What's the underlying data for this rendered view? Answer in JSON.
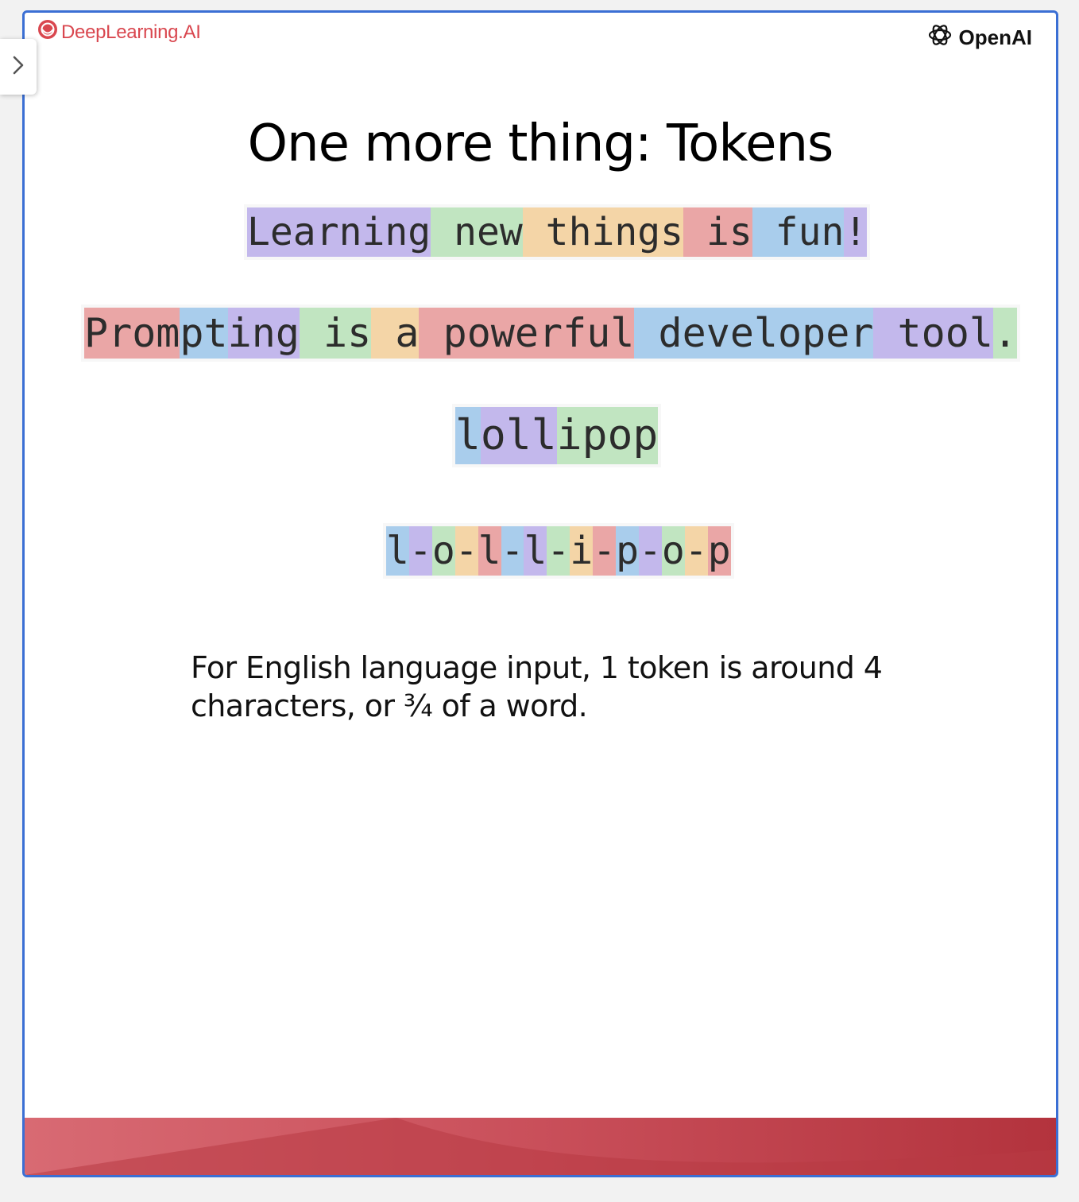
{
  "brand": {
    "left_logo_text": "DeepLearning.AI",
    "right_logo_text": "OpenAI"
  },
  "slide": {
    "title": "One more thing: Tokens",
    "caption": "For English language input, 1 token is around 4 characters, or ¾ of a word."
  },
  "colors": {
    "purple": "#c3b8ec",
    "green": "#c1e5c1",
    "orange": "#f4d5a7",
    "red": "#eaa6a6",
    "blue": "#a9cdec",
    "frame": "#3b6fd4",
    "brand_red": "#d9474f"
  },
  "token_lines": [
    {
      "id": "learning",
      "tokens": [
        {
          "text": "Learning",
          "color": "purple"
        },
        {
          "text": " new",
          "color": "green"
        },
        {
          "text": " things",
          "color": "orange"
        },
        {
          "text": " is",
          "color": "red"
        },
        {
          "text": " fun",
          "color": "blue"
        },
        {
          "text": "!",
          "color": "purple"
        }
      ]
    },
    {
      "id": "prompting",
      "tokens": [
        {
          "text": "Prom",
          "color": "red"
        },
        {
          "text": "pt",
          "color": "blue"
        },
        {
          "text": "ing",
          "color": "purple"
        },
        {
          "text": " is",
          "color": "green"
        },
        {
          "text": " a",
          "color": "orange"
        },
        {
          "text": " powerful",
          "color": "red"
        },
        {
          "text": " developer",
          "color": "blue"
        },
        {
          "text": " tool",
          "color": "purple"
        },
        {
          "text": ".",
          "color": "green"
        }
      ]
    },
    {
      "id": "lollipop",
      "tokens": [
        {
          "text": "l",
          "color": "blue"
        },
        {
          "text": "oll",
          "color": "purple"
        },
        {
          "text": "ipop",
          "color": "green"
        }
      ]
    },
    {
      "id": "lollipop-dashed",
      "tokens": [
        {
          "text": "l",
          "color": "blue"
        },
        {
          "text": "-",
          "color": "purple"
        },
        {
          "text": "o",
          "color": "green"
        },
        {
          "text": "-",
          "color": "orange"
        },
        {
          "text": "l",
          "color": "red"
        },
        {
          "text": "-",
          "color": "blue"
        },
        {
          "text": "l",
          "color": "purple"
        },
        {
          "text": "-",
          "color": "green"
        },
        {
          "text": "i",
          "color": "orange"
        },
        {
          "text": "-",
          "color": "red"
        },
        {
          "text": "p",
          "color": "blue"
        },
        {
          "text": "-",
          "color": "purple"
        },
        {
          "text": "o",
          "color": "green"
        },
        {
          "text": "-",
          "color": "orange"
        },
        {
          "text": "p",
          "color": "red"
        }
      ]
    }
  ]
}
